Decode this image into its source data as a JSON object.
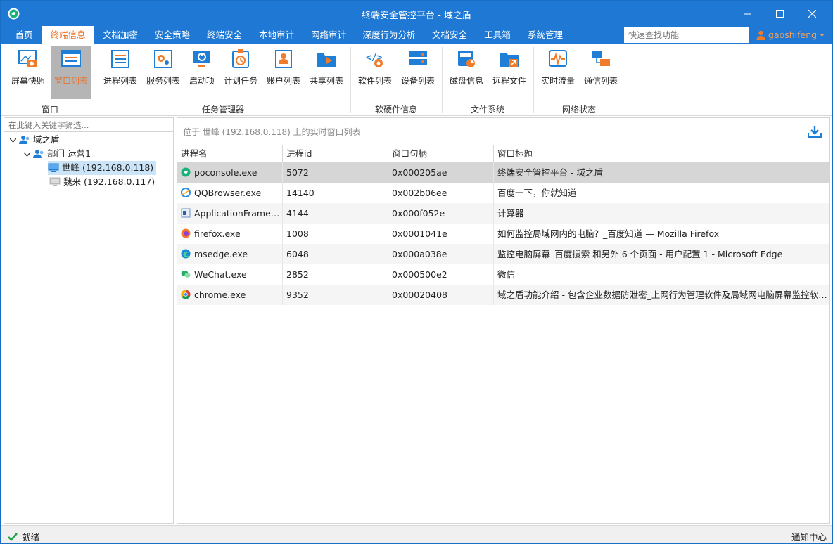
{
  "window": {
    "title": "终端安全管控平台 - 域之盾"
  },
  "menu": {
    "items": [
      "首页",
      "终端信息",
      "文档加密",
      "安全策略",
      "终端安全",
      "本地审计",
      "网络审计",
      "深度行为分析",
      "文档安全",
      "工具箱",
      "系统管理"
    ],
    "active": "终端信息",
    "search_placeholder": "快速查找功能",
    "user": "gaoshifeng"
  },
  "ribbon": {
    "buttons": [
      "屏幕快照",
      "窗口列表",
      "进程列表",
      "服务列表",
      "启动项",
      "计划任务",
      "账户列表",
      "共享列表",
      "软件列表",
      "设备列表",
      "磁盘信息",
      "远程文件",
      "实时流量",
      "通信列表"
    ],
    "active": "窗口列表",
    "groups": [
      "窗口",
      "任务管理器",
      "软硬件信息",
      "文件系统",
      "网络状态"
    ]
  },
  "tree": {
    "filter_placeholder": "在此键入关键字筛选...",
    "root": "域之盾",
    "dept": "部门 运营1",
    "hosts": [
      "世峰 (192.168.0.118)",
      "魏来 (192.168.0.117)"
    ],
    "selected": "世峰 (192.168.0.118)"
  },
  "content": {
    "header": "位于 世峰 (192.168.0.118) 上的实时窗口列表",
    "columns": [
      "进程名",
      "进程id",
      "窗口句柄",
      "窗口标题"
    ],
    "rows": [
      {
        "name": "poconsole.exe",
        "pid": "5072",
        "handle": "0x000205ae",
        "title": "终端安全管控平台 - 域之盾",
        "icon": "poconsole-icon"
      },
      {
        "name": "QQBrowser.exe",
        "pid": "14140",
        "handle": "0x002b06ee",
        "title": "百度一下，你就知道",
        "icon": "qqbrowser-icon"
      },
      {
        "name": "ApplicationFrameH...",
        "pid": "4144",
        "handle": "0x000f052e",
        "title": "计算器",
        "icon": "app-frame-icon"
      },
      {
        "name": "firefox.exe",
        "pid": "1008",
        "handle": "0x0001041e",
        "title": "如何监控局域网内的电脑？_百度知道 — Mozilla Firefox",
        "icon": "firefox-icon"
      },
      {
        "name": "msedge.exe",
        "pid": "6048",
        "handle": "0x000a038e",
        "title": "监控电脑屏幕_百度搜索 和另外 6 个页面 - 用户配置 1 - Microsoft Edge",
        "icon": "edge-icon"
      },
      {
        "name": "WeChat.exe",
        "pid": "2852",
        "handle": "0x000500e2",
        "title": "微信",
        "icon": "wechat-icon"
      },
      {
        "name": "chrome.exe",
        "pid": "9352",
        "handle": "0x00020408",
        "title": "域之盾功能介绍 - 包含企业数据防泄密_上网行为管理软件及局域网电脑屏幕监控软件...",
        "icon": "chrome-icon"
      }
    ],
    "selected_row": 0
  },
  "status": {
    "text": "就绪",
    "notify": "通知中心"
  },
  "colors": {
    "accent": "#1e78d4",
    "active_orange": "#e8732a",
    "icon_blue": "#1f7fd6",
    "icon_orange": "#f07c2b"
  }
}
